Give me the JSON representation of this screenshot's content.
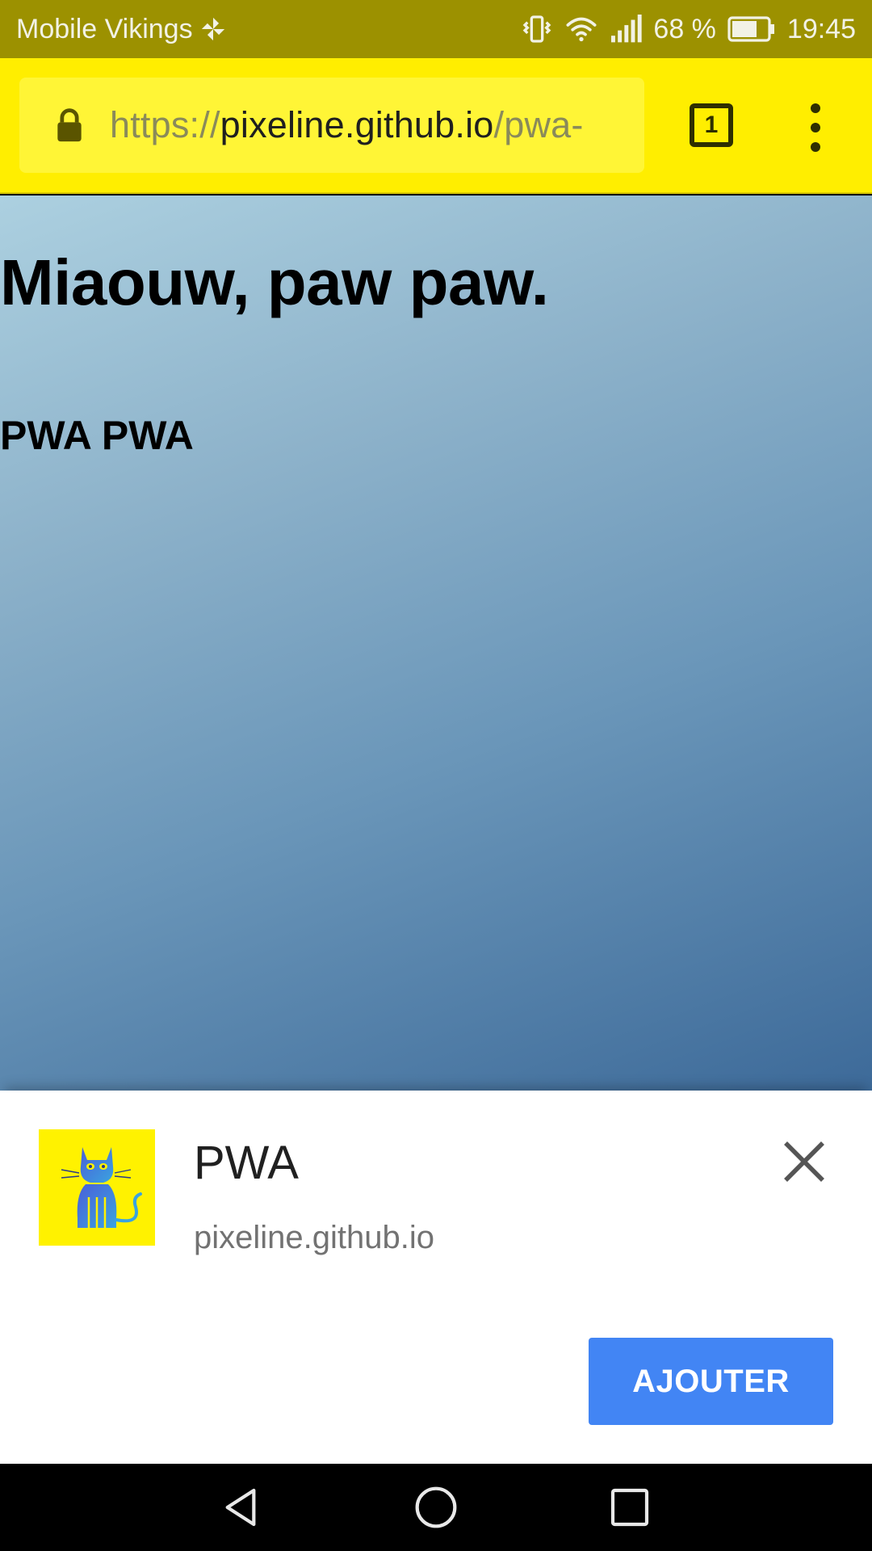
{
  "status_bar": {
    "carrier": "Mobile Vikings",
    "battery_percent": "68 %",
    "time": "19:45",
    "icons": [
      "pinwheel-icon",
      "vibrate-icon",
      "wifi-icon",
      "signal-icon",
      "battery-icon"
    ]
  },
  "browser": {
    "url_scheme": "https://",
    "url_host": "pixeline.github.io",
    "url_path": "/pwa-",
    "tab_count": "1",
    "toolbar_color": "#ffee00"
  },
  "page": {
    "heading": "Miaouw, paw paw.",
    "subheading": "PWA PWA"
  },
  "install_banner": {
    "app_name": "PWA",
    "origin": "pixeline.github.io",
    "add_label": "AJOUTER",
    "accent_color": "#4285f4"
  },
  "nav_bar": {
    "icons": [
      "back-icon",
      "home-icon",
      "recents-icon"
    ]
  }
}
